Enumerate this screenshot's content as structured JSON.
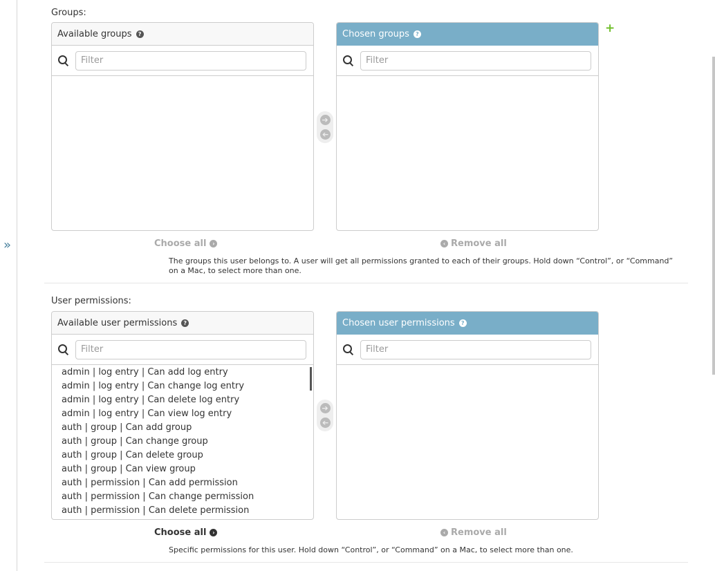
{
  "sidebar": {
    "toggle_label": "»"
  },
  "groups": {
    "label": "Groups:",
    "available": {
      "title": "Available groups",
      "help": "?",
      "filter_placeholder": "Filter",
      "options": []
    },
    "chosen": {
      "title": "Chosen groups",
      "help": "?",
      "filter_placeholder": "Filter",
      "options": []
    },
    "add_related": "+",
    "move_right": "➔",
    "move_left": "➔",
    "choose_all": "Choose all",
    "remove_all": "Remove all",
    "help_text": "The groups this user belongs to. A user will get all permissions granted to each of their groups. Hold down “Control”, or “Command” on a Mac, to select more than one."
  },
  "user_permissions": {
    "label": "User permissions:",
    "available": {
      "title": "Available user permissions",
      "help": "?",
      "filter_placeholder": "Filter",
      "options": [
        "admin | log entry | Can add log entry",
        "admin | log entry | Can change log entry",
        "admin | log entry | Can delete log entry",
        "admin | log entry | Can view log entry",
        "auth | group | Can add group",
        "auth | group | Can change group",
        "auth | group | Can delete group",
        "auth | group | Can view group",
        "auth | permission | Can add permission",
        "auth | permission | Can change permission",
        "auth | permission | Can delete permission"
      ]
    },
    "chosen": {
      "title": "Chosen user permissions",
      "help": "?",
      "filter_placeholder": "Filter",
      "options": []
    },
    "move_right": "➔",
    "move_left": "➔",
    "choose_all": "Choose all",
    "remove_all": "Remove all",
    "help_text": "Specific permissions for this user. Hold down “Control”, or “Command” on a Mac, to select more than one."
  },
  "icons": {
    "help": "help-icon",
    "search": "search-icon",
    "add": "plus-icon",
    "arrow_right": "arrow-right-circle-icon",
    "arrow_left": "arrow-left-circle-icon",
    "sidebar_toggle": "double-chevron-right-icon"
  },
  "colors": {
    "chosen_header": "#79aec8",
    "add_green": "#70bf2b",
    "link_blue": "#447e9b"
  }
}
